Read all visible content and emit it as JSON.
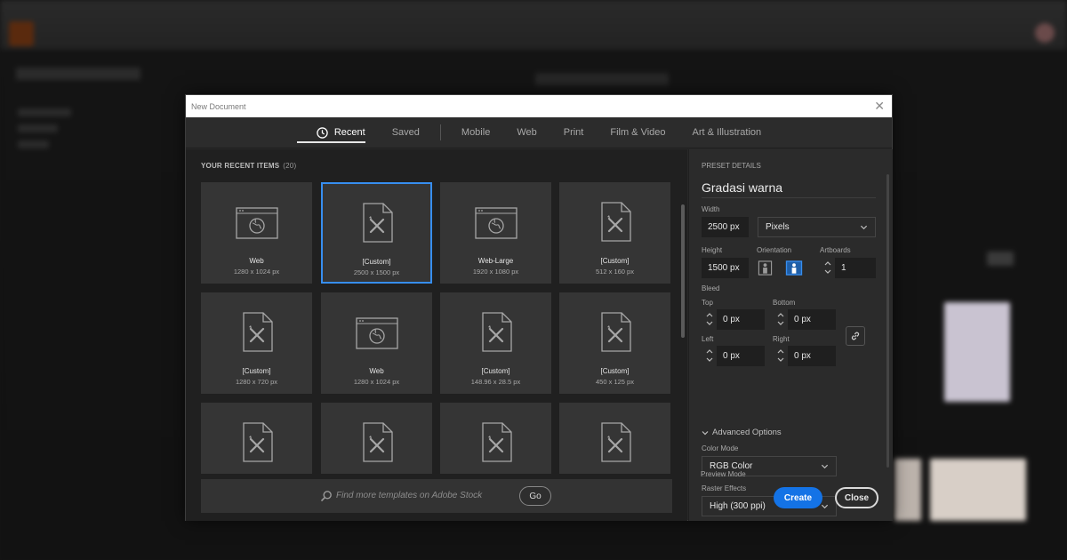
{
  "dialog": {
    "title": "New Document",
    "close_glyph": "✕"
  },
  "tabs": [
    {
      "label": "Recent",
      "icon": "clock-icon",
      "active": true
    },
    {
      "label": "Saved"
    },
    {
      "label": "Mobile"
    },
    {
      "label": "Web"
    },
    {
      "label": "Print"
    },
    {
      "label": "Film & Video"
    },
    {
      "label": "Art & Illustration"
    }
  ],
  "recent": {
    "heading": "YOUR RECENT ITEMS",
    "count": "(20)",
    "items": [
      {
        "icon": "web-document-icon",
        "name": "Web",
        "size": "1280 x 1024 px"
      },
      {
        "icon": "custom-document-icon",
        "name": "[Custom]",
        "size": "2500 x 1500 px",
        "selected": true
      },
      {
        "icon": "web-document-icon",
        "name": "Web-Large",
        "size": "1920 x 1080 px"
      },
      {
        "icon": "custom-document-icon",
        "name": "[Custom]",
        "size": "512 x 160 px"
      },
      {
        "icon": "custom-document-icon",
        "name": "[Custom]",
        "size": "1280 x 720 px"
      },
      {
        "icon": "web-document-icon",
        "name": "Web",
        "size": "1280 x 1024 px"
      },
      {
        "icon": "custom-document-icon",
        "name": "[Custom]",
        "size": "148.96 x 28.5 px"
      },
      {
        "icon": "custom-document-icon",
        "name": "[Custom]",
        "size": "450 x 125 px"
      },
      {
        "icon": "custom-document-icon",
        "name": "",
        "size": ""
      },
      {
        "icon": "custom-document-icon",
        "name": "",
        "size": ""
      },
      {
        "icon": "custom-document-icon",
        "name": "",
        "size": ""
      },
      {
        "icon": "custom-document-icon",
        "name": "",
        "size": ""
      }
    ]
  },
  "search": {
    "placeholder": "Find more templates on Adobe Stock",
    "go_label": "Go"
  },
  "preset": {
    "heading": "PRESET DETAILS",
    "name": "Gradasi warna",
    "width_label": "Width",
    "width_value": "2500 px",
    "units_value": "Pixels",
    "height_label": "Height",
    "height_value": "1500 px",
    "orientation_label": "Orientation",
    "artboards_label": "Artboards",
    "artboards_value": "1",
    "bleed_label": "Bleed",
    "bleed_top_label": "Top",
    "bleed_top_value": "0 px",
    "bleed_bottom_label": "Bottom",
    "bleed_bottom_value": "0 px",
    "bleed_left_label": "Left",
    "bleed_left_value": "0 px",
    "bleed_right_label": "Right",
    "bleed_right_value": "0 px",
    "advanced_label": "Advanced Options",
    "color_mode_label": "Color Mode",
    "color_mode_value": "RGB Color",
    "raster_label": "Raster Effects",
    "raster_value": "High (300 ppi)",
    "preview_label": "Preview Mode",
    "create_label": "Create",
    "close_label": "Close"
  },
  "colors": {
    "accent": "#378ef0",
    "create_button": "#1473e6",
    "dialog_bg": "#282828",
    "grid_bg": "#202020",
    "tile_bg": "#353535"
  }
}
